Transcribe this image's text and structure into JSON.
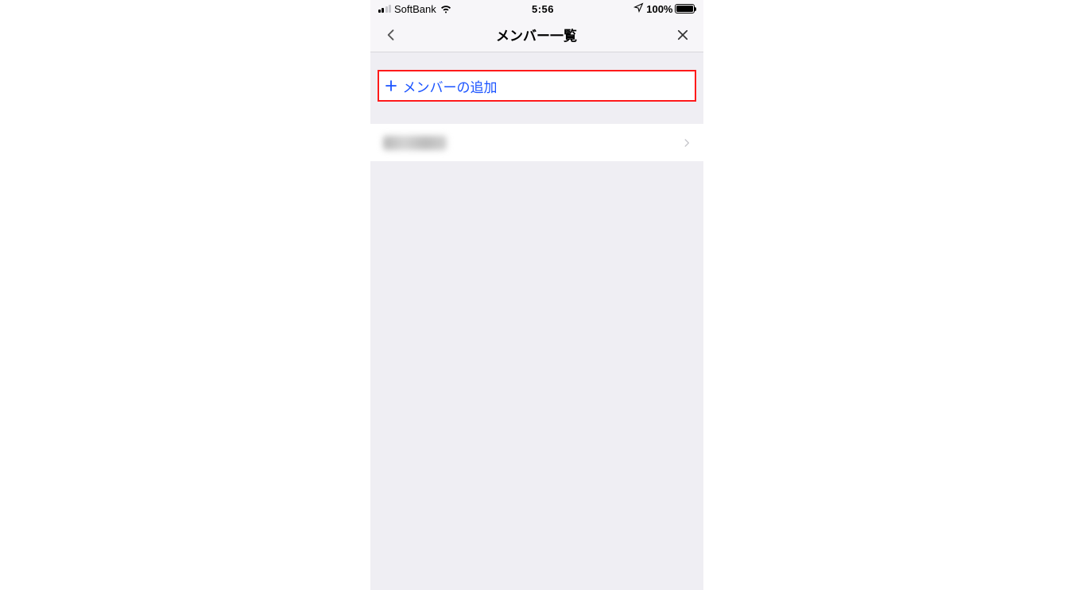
{
  "status": {
    "carrier": "SoftBank",
    "time": "5:56",
    "battery_percent": "100%",
    "battery_fill_pct": 100
  },
  "nav": {
    "title": "メンバー一覧"
  },
  "add_member": {
    "label": "メンバーの追加"
  }
}
